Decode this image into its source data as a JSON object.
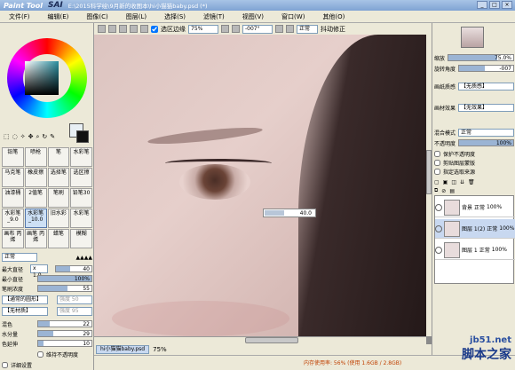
{
  "app": {
    "logo_left": "Paint Tool",
    "logo_right": "SAI",
    "title": "E:\\2015科学绘\\9月新的收图本\\hi小猫猫baby.psd (*)"
  },
  "menu": [
    "文件(F)",
    "编辑(E)",
    "图像(C)",
    "图层(L)",
    "选择(S)",
    "滤镜(T)",
    "视图(V)",
    "窗口(W)",
    "其他(O)"
  ],
  "toolbar": {
    "selection_edge_label": "选区边缘",
    "zoom": "75%",
    "angle": "-007°",
    "blend": "正常",
    "stabilizer_label": "抖动修正"
  },
  "left": {
    "tools": [
      "铅笔",
      "喷枪",
      "笔",
      "水彩笔",
      "马克笔",
      "橡皮擦",
      "选择笔",
      "选区擦",
      "油漆桶",
      "2值笔",
      "笔刷",
      "铅笔30",
      "水彩笔_9.0",
      "水彩笔_10.0",
      "旧水彩",
      "水彩笔",
      "画布\n丙烯",
      "画笔\n丙烯",
      "蜡笔",
      "模糊"
    ],
    "blend_mode": "正常",
    "max_diam_label": "最大直径",
    "max_diam_mult": "x 1.0",
    "max_diam_val": "40",
    "min_diam_label": "最小直径",
    "min_diam_val": "100%",
    "density_label": "笔刷浓度",
    "density_val": "55",
    "shape_label": "【通常的圆形】",
    "shape_val": "强度 50",
    "texture_label": "【无材质】",
    "texture_val": "强度 95",
    "blend_label": "混色",
    "blend_val": "22",
    "water_label": "水分量",
    "water_val": "29",
    "persist_label": "色延伸",
    "persist_val": "10",
    "keep_opacity_label": "维持不透明度",
    "detail_label": "详细设置"
  },
  "canvas": {
    "brush_size_popup": "40.0",
    "file_tab": "hi小猫猫baby.psd",
    "file_zoom": "75%"
  },
  "status": {
    "memory": "内存使用率: 56% (使用 1.6GB / 2.8GB)"
  },
  "right": {
    "zoom_label": "缩放",
    "zoom_val": "75.0%",
    "rotate_label": "旋转角度",
    "rotate_val": "-007",
    "paper_texture_label": "画纸质感",
    "paper_texture_val": "【无质感】",
    "paper_effect_label": "画材效果",
    "paper_effect_val": "【无效果】",
    "mode_label": "混合模式",
    "mode_val": "正常",
    "opacity_label": "不透明度",
    "opacity_val": "100%",
    "protect_label": "保护不透明度",
    "clip_label": "剪贴图层蒙版",
    "source_label": "指定选取来源",
    "layers": [
      {
        "name": "背景",
        "mode": "正常",
        "opacity": "100%"
      },
      {
        "name": "图层 1(2)",
        "mode": "正常",
        "opacity": "100%"
      },
      {
        "name": "图层 1",
        "mode": "正常",
        "opacity": "100%"
      }
    ]
  },
  "watermark": {
    "line1": "jb51.net",
    "line2": "脚本之家"
  }
}
